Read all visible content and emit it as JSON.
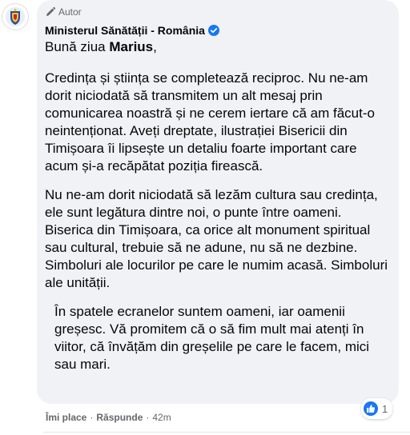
{
  "comment": {
    "author_badge": "Autor",
    "author_name": "Ministerul Sănătății - România",
    "greeting_prefix": "Bună ziua ",
    "greeting_name": "Marius",
    "greeting_suffix": ",",
    "paragraphs": [
      "Credința și știința se completează reciproc. Nu ne-am dorit niciodată să transmitem un alt mesaj prin comunicarea noastră și ne cerem iertare că am făcut-o neintenționat. Aveți dreptate, ilustrației Bisericii din Timișoara îi lipsește un detaliu foarte important care acum și-a recăpătat poziția firească.",
      "Nu ne-am dorit niciodată să lezăm cultura sau credința, ele sunt legătura dintre noi, o punte între oameni. Biserica din Timișoara, ca orice alt monument spiritual sau cultural, trebuie să ne adune, nu să ne dezbine. Simboluri ale locurilor pe care le numim acasă. Simboluri ale unității.",
      "În spatele ecranelor suntem oameni, iar oamenii greșesc. Vă promitem că o să fim mult mai atenți în viitor, că învățăm din greșelile pe care le facem, mici sau mari."
    ],
    "reaction_count": "1",
    "reaction_icon": "like-thumb-icon"
  },
  "actions": {
    "like": "Îmi place",
    "separator": "·",
    "reply": "Răspunde",
    "time": "42m"
  },
  "colors": {
    "bubble": "#f0f2f5",
    "secondary_text": "#65676b",
    "verified": "#1877f2",
    "like": "#1877f2"
  }
}
